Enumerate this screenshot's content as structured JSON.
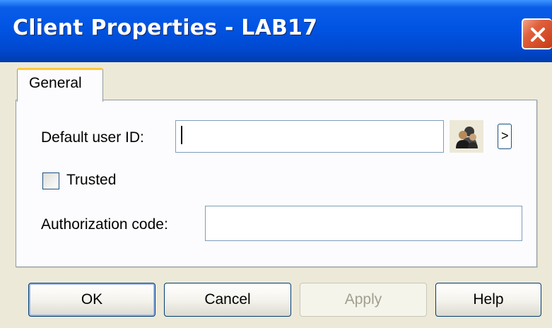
{
  "window": {
    "title": "Client Properties - LAB17"
  },
  "tabs": [
    {
      "label": "General",
      "selected": true
    }
  ],
  "form": {
    "default_user_id": {
      "label": "Default user ID:",
      "value": ""
    },
    "trusted": {
      "label": "Trusted",
      "checked": false
    },
    "authorization_code": {
      "label": "Authorization code:",
      "value": ""
    },
    "users_button_icon": "users-icon",
    "arrow_button_label": ">"
  },
  "buttons": {
    "ok": "OK",
    "cancel": "Cancel",
    "apply": "Apply",
    "help": "Help"
  },
  "colors": {
    "titlebar": "#0054e3",
    "dialog_bg": "#ece9d8",
    "tab_highlight": "#ffc83c",
    "close_button": "#e0603c"
  }
}
